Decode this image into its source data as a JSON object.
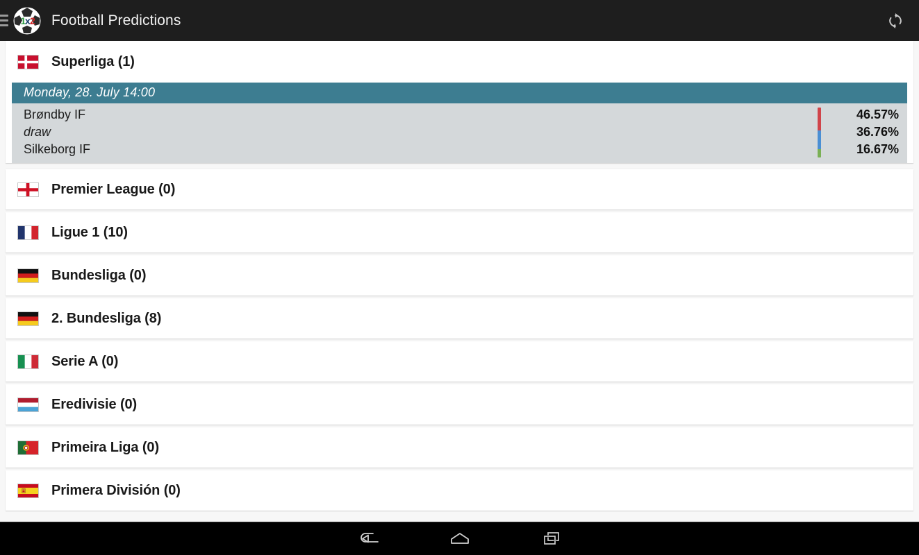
{
  "appbar": {
    "title": "Football Predictions",
    "menu_icon": "hamburger-menu-icon",
    "logo_icon": "app-logo-soccer-ball-1x2",
    "logo_text_1": "1",
    "logo_text_x": "x",
    "logo_text_2": "2",
    "refresh_icon": "refresh-icon",
    "background_color": "#1e1e1e",
    "title_color": "#f2f2f2"
  },
  "colors": {
    "page_background": "#f7f7f7",
    "card_background": "#ffffff",
    "match_block_background": "#d4d8da",
    "match_date_background": "#3d7d91",
    "home_bar": "#d0444a",
    "draw_bar": "#4a8fd4",
    "away_bar": "#7ab055",
    "navbar_background": "#000000"
  },
  "featured_league": {
    "flag": "flag-denmark",
    "name": "Superliga (1)"
  },
  "match": {
    "date": "Monday, 28. July 14:00",
    "home_team": "Brøndby IF",
    "draw_label": "draw",
    "away_team": "Silkeborg IF",
    "home_percent": "46.57%",
    "draw_percent": "36.76%",
    "away_percent": "16.67%",
    "home_value": 46.57,
    "draw_value": 36.76,
    "away_value": 16.67
  },
  "leagues": [
    {
      "flag": "flag-england",
      "name": "Premier League (0)"
    },
    {
      "flag": "flag-france",
      "name": "Ligue 1 (10)"
    },
    {
      "flag": "flag-germany",
      "name": "Bundesliga (0)"
    },
    {
      "flag": "flag-germany",
      "name": "2. Bundesliga (8)"
    },
    {
      "flag": "flag-italy",
      "name": "Serie A (0)"
    },
    {
      "flag": "flag-netherlands",
      "name": "Eredivisie (0)"
    },
    {
      "flag": "flag-portugal",
      "name": "Primeira Liga (0)"
    },
    {
      "flag": "flag-spain",
      "name": "Primera División (0)"
    }
  ],
  "navbar": {
    "back_icon": "back-arrow-icon",
    "home_icon": "home-icon",
    "recents_icon": "recent-apps-icon"
  }
}
